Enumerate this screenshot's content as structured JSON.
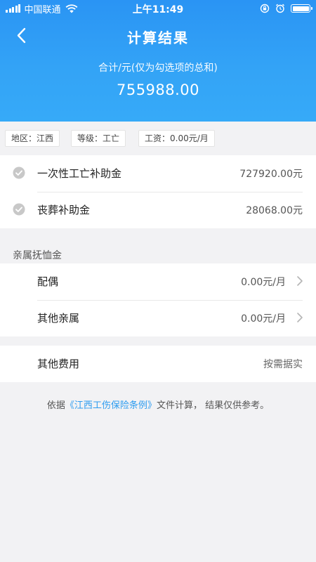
{
  "status_bar": {
    "carrier": "中国联通",
    "time": "上午11:49"
  },
  "nav": {
    "title": "计算结果"
  },
  "summary": {
    "label": "合计/元(仅为勾选项的总和)",
    "total": "755988.00"
  },
  "tags": [
    "地区：江西",
    "等级：工亡",
    "工资：0.00元/月"
  ],
  "items": [
    {
      "label": "一次性工亡补助金",
      "amount": "727920.00元",
      "checked": true
    },
    {
      "label": "丧葬补助金",
      "amount": "28068.00元",
      "checked": true
    }
  ],
  "relatives_section": {
    "title": "亲属抚恤金",
    "rows": [
      {
        "label": "配偶",
        "amount": "0.00元/月"
      },
      {
        "label": "其他亲属",
        "amount": "0.00元/月"
      }
    ]
  },
  "other_fees": {
    "label": "其他费用",
    "value": "按需据实"
  },
  "footer": {
    "prefix": "依据",
    "link": "《江西工伤保险条例》",
    "suffix": "文件计算， 结果仅供参考。"
  },
  "colors": {
    "header_blue": "#2a94f4",
    "link_blue": "#2d9cf0",
    "check_gray": "#c8c8c8"
  }
}
